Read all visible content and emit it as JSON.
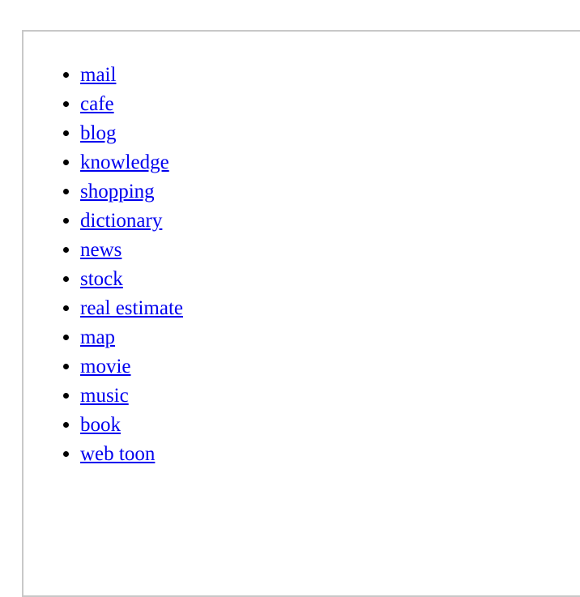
{
  "page": {
    "background_color": "#ffffff",
    "box_border_color": "#c8c8c8",
    "link_color": "#0000ee",
    "bullet_color": "#000000"
  },
  "list": {
    "marker": "disc",
    "items": [
      {
        "label": "mail"
      },
      {
        "label": "cafe"
      },
      {
        "label": "blog"
      },
      {
        "label": "knowledge"
      },
      {
        "label": "shopping"
      },
      {
        "label": "dictionary"
      },
      {
        "label": "news"
      },
      {
        "label": "stock"
      },
      {
        "label": "real estimate"
      },
      {
        "label": "map"
      },
      {
        "label": "movie"
      },
      {
        "label": "music"
      },
      {
        "label": "book"
      },
      {
        "label": "web toon"
      }
    ]
  }
}
